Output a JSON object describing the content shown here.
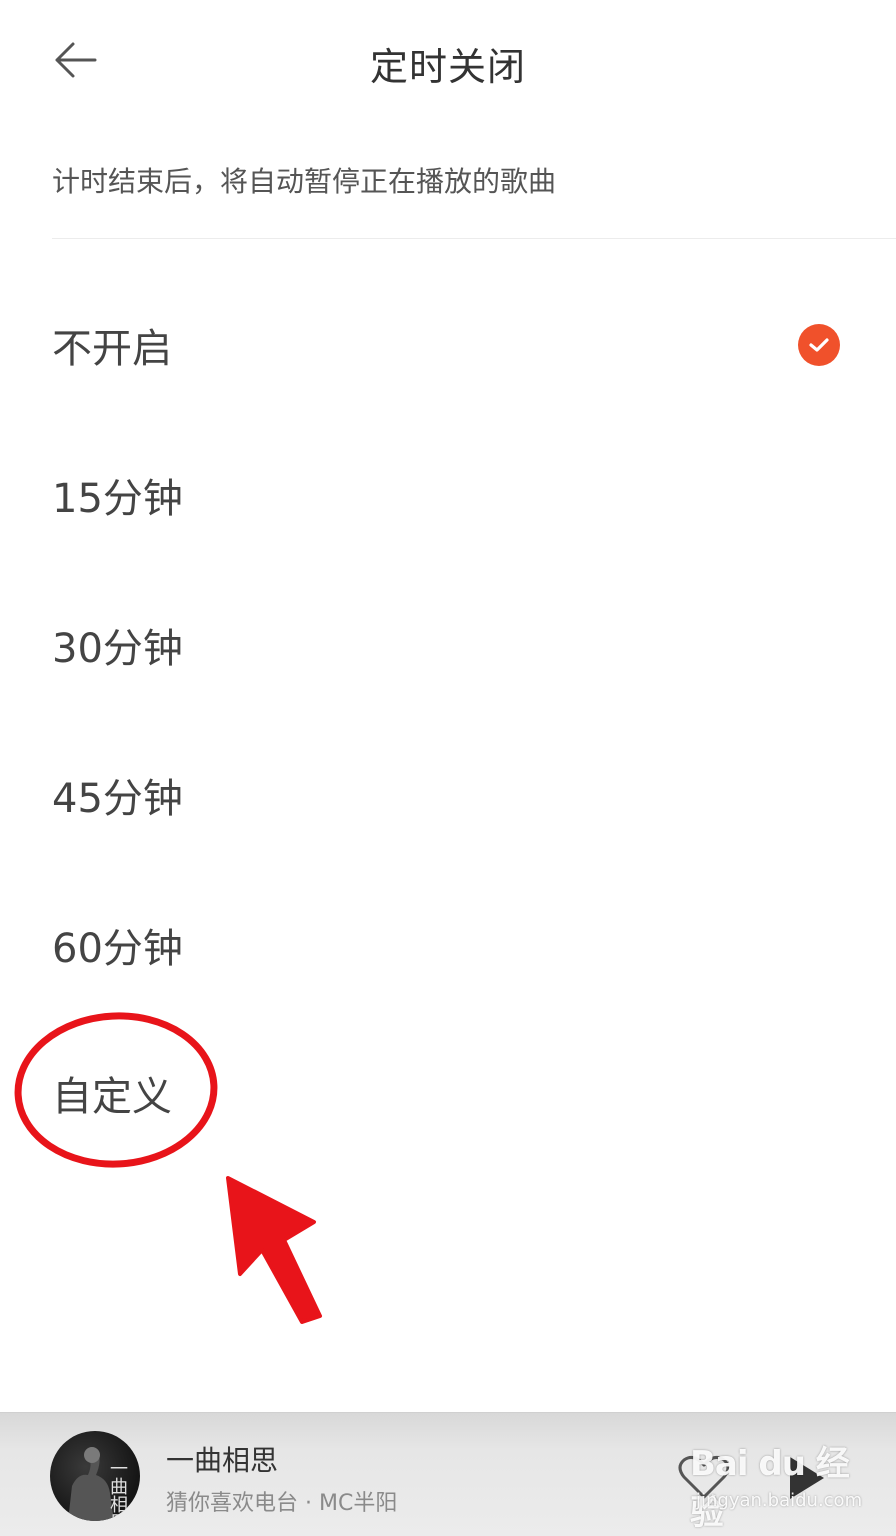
{
  "header": {
    "title": "定时关闭",
    "back_icon": "arrow-left-icon"
  },
  "subtitle": "计时结束后，将自动暂停正在播放的歌曲",
  "options": [
    {
      "label": "不开启",
      "selected": true
    },
    {
      "label": "15分钟",
      "selected": false
    },
    {
      "label": "30分钟",
      "selected": false
    },
    {
      "label": "45分钟",
      "selected": false
    },
    {
      "label": "60分钟",
      "selected": false
    },
    {
      "label": "自定义",
      "selected": false
    }
  ],
  "colors": {
    "accent": "#f0512b",
    "annotation_red": "#e8141a",
    "text_primary": "#333333",
    "text_secondary": "#8a8a8a"
  },
  "player": {
    "song_title": "一曲相思",
    "song_subtitle": "猜你喜欢电台 · MC半阳",
    "album_text": "一曲相思",
    "heart_icon": "heart-outline-icon",
    "play_icon": "play-icon"
  },
  "watermark": {
    "logo": "Bai du 经验",
    "url": "jingyan.baidu.com"
  }
}
